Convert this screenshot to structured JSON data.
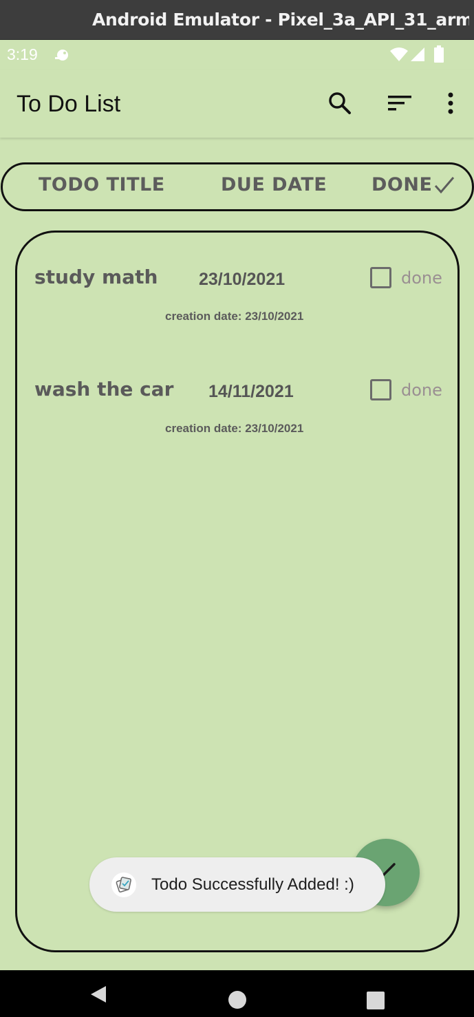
{
  "window": {
    "title": "Android Emulator - Pixel_3a_API_31_arm..."
  },
  "status_bar": {
    "time": "3:19",
    "icons": [
      "notification-icon",
      "wifi-icon",
      "signal-icon",
      "battery-icon"
    ]
  },
  "app_bar": {
    "title": "To Do List",
    "actions": [
      "search-icon",
      "sort-icon",
      "more-vert-icon"
    ]
  },
  "columns": {
    "title": "TODO TITLE",
    "due": "DUE DATE",
    "done": "DONE"
  },
  "todos": [
    {
      "title": "study math",
      "due_date": "23/10/2021",
      "done_label": "done",
      "checked": false,
      "created": "creation date: 23/10/2021"
    },
    {
      "title": "wash the car",
      "due_date": "14/11/2021",
      "done_label": "done",
      "checked": false,
      "created": "creation date: 23/10/2021"
    }
  ],
  "toast": {
    "message": "Todo Successfully Added! :)"
  },
  "fab": {
    "icon": "edit-icon"
  },
  "colors": {
    "background": "#cde3b3",
    "fab": "#6aa472",
    "text": "#5a5a5a"
  }
}
